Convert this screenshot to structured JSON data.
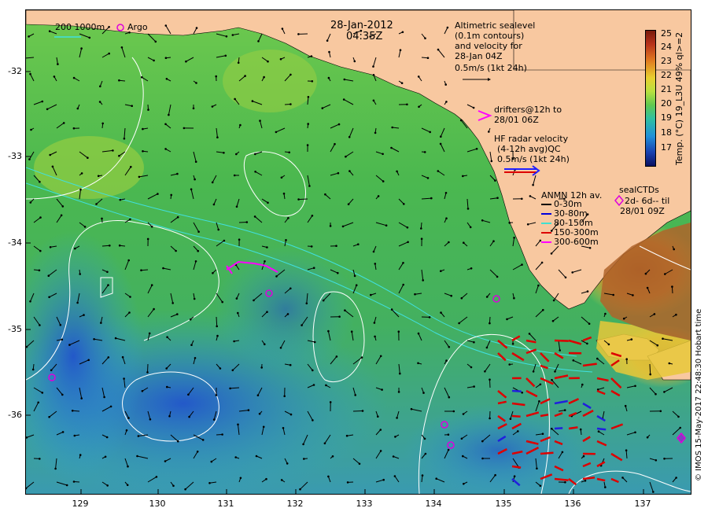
{
  "header": {
    "date": "28-Jan-2012",
    "time": "04:35Z"
  },
  "legend_top_left": {
    "isobaths": "200  1000m",
    "argo": "Argo"
  },
  "altimetry_note": {
    "line1": "Altimetric sealevel",
    "line2": "(0.1m contours)",
    "line3": "and velocity for",
    "line4": "28-Jan 04Z",
    "line5": "0.5m/s (1kt 24h)"
  },
  "drifters_note": {
    "line1": "drifters@12h to",
    "line2": "28/01 06Z"
  },
  "hf_radar_note": {
    "line1": "HF radar velocity",
    "line2": "(4-12h avg)QC",
    "line3": "0.5m/s (1kt 24h)"
  },
  "anmn_legend": {
    "title": "ANMN 12h av.",
    "items": [
      {
        "label": "0-30m",
        "color": "#000000"
      },
      {
        "label": "30-80m",
        "color": "#0000dd"
      },
      {
        "label": "80-150m",
        "color": "#40e0d0"
      },
      {
        "label": "150-300m",
        "color": "#dd0000"
      },
      {
        "label": "300-600m",
        "color": "#ff00ff"
      }
    ]
  },
  "seal_ctds": {
    "title": "sealCTDs",
    "line1": "2d- 6d-- til",
    "line2": "28/01 09Z"
  },
  "colorbar": {
    "title": "Temp. (°C) 19_L3U 49% ql>=2",
    "ticks": [
      "25",
      "24",
      "23",
      "22",
      "21",
      "20",
      "19",
      "18",
      "17"
    ]
  },
  "axes": {
    "y_ticks": [
      "-32",
      "-33",
      "-34",
      "-35",
      "-36"
    ],
    "x_ticks": [
      "129",
      "130",
      "131",
      "132",
      "133",
      "134",
      "135",
      "136",
      "137"
    ]
  },
  "copyright": "© IMOS 15-May-2017 22:48:30 Hobart time",
  "colors": {
    "land": "#f8c8a0",
    "sst_warm": "#c0392b",
    "sst_mid": "#4caf50",
    "sst_cool": "#3090e0",
    "argo_marker": "#dd00dd"
  }
}
